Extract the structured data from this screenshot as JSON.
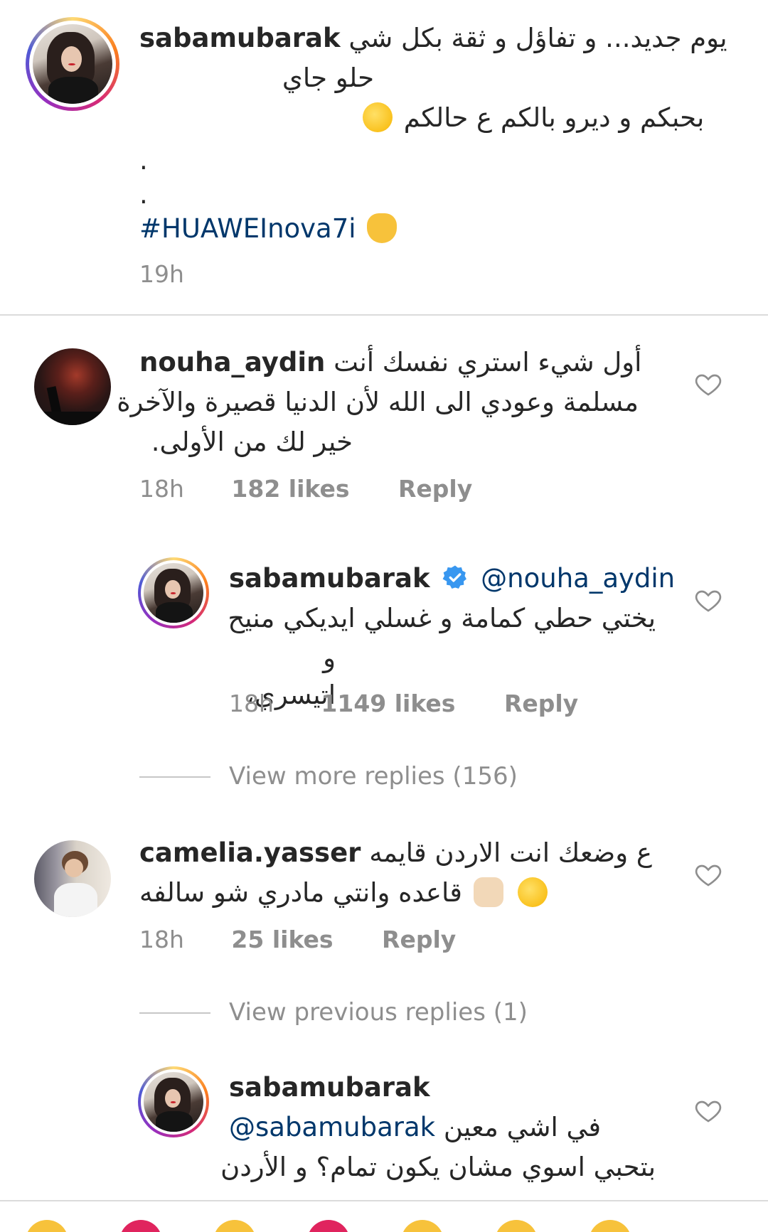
{
  "caption": {
    "username": "sabamubarak",
    "line1": "يوم جديد... و تفاؤل و ثقة بكل شي",
    "line2": "حلو جاي",
    "line3": "بحبكم و ديرو بالكم ع حالكم",
    "dot1": ".",
    "dot2": ".",
    "hashtag": "#HUAWEInova7i",
    "time": "19h"
  },
  "comments": [
    {
      "username": "nouha_aydin",
      "line1": "أول شيء استري نفسك أنت",
      "line2": "مسلمة وعودي الى الله لأن الدنيا قصيرة والآخرة",
      "line3": "خير لك من الأولى.",
      "time": "18h",
      "likes": "182 likes",
      "reply": "Reply"
    },
    {
      "username": "sabamubarak",
      "mention": "@nouha_aydin",
      "line1": "يختي حطي كمامة و غسلي ايديكي منيح",
      "line2": "و اتيسري،",
      "time": "18h",
      "likes": "1149 likes",
      "reply": "Reply"
    },
    {
      "view_more": "View more replies (156)"
    },
    {
      "username": "camelia.yasser",
      "line1": "ع وضعك انت الاردن قايمه",
      "line2": "قاعده وانتي مادري شو سالفه",
      "time": "18h",
      "likes": "25 likes",
      "reply": "Reply"
    },
    {
      "view_previous": "View previous replies (1)"
    },
    {
      "username": "sabamubarak",
      "mention": "@sabamubarak",
      "line1": "في اشي معين",
      "line2": "بتحبي اسوي مشان يكون تمام؟ و الأردن"
    }
  ],
  "colors": {
    "text": "#262626",
    "muted": "#8e8e8e",
    "link": "#00376b",
    "verified": "#3897f0",
    "divider": "#dbdbdb"
  },
  "icons": {
    "like": "heart-outline-icon",
    "verified": "verified-badge-icon",
    "kiss": "face-blowing-kiss-emoji",
    "ok": "ok-hand-emoji",
    "laugh": "tears-of-joy-emoji",
    "thumbs": "thumbs-up-emoji"
  }
}
